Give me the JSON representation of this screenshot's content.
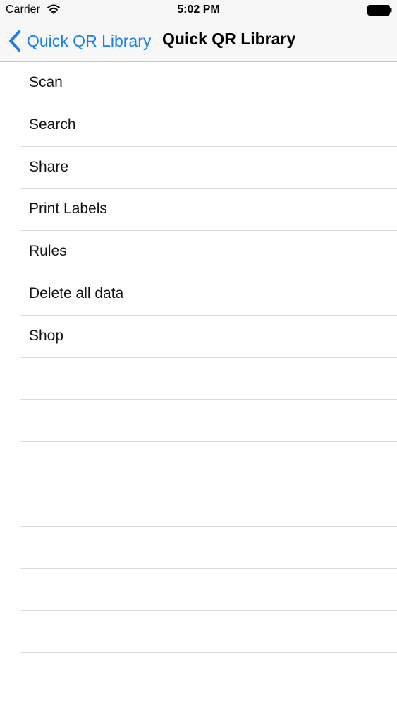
{
  "status_bar": {
    "carrier": "Carrier",
    "time": "5:02 PM",
    "wifi_icon": "wifi-icon",
    "battery_icon": "battery-icon"
  },
  "nav": {
    "back_label": "Quick QR Library",
    "title": "Quick QR Library",
    "back_icon": "chevron-left-icon",
    "accent_color": "#1a7fe6"
  },
  "menu": {
    "items": [
      {
        "label": "Scan"
      },
      {
        "label": "Search"
      },
      {
        "label": "Share"
      },
      {
        "label": "Print Labels"
      },
      {
        "label": "Rules"
      },
      {
        "label": "Delete all data"
      },
      {
        "label": "Shop"
      }
    ],
    "empty_rows": 8
  }
}
